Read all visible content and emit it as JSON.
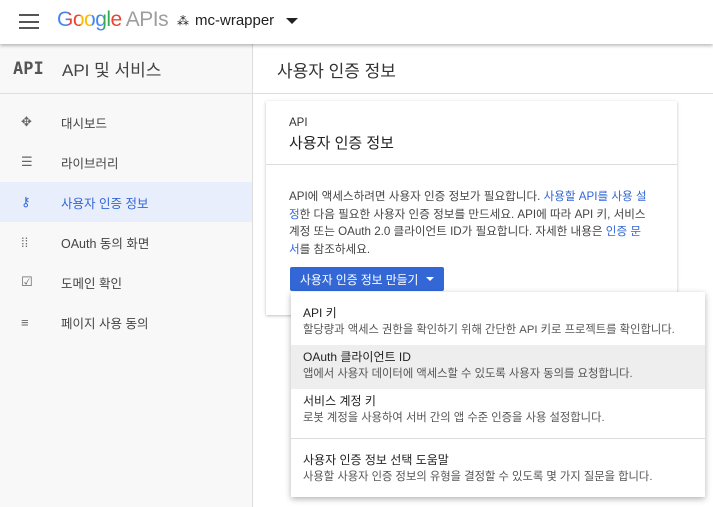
{
  "header": {
    "logo_google": "Google",
    "logo_apis": "APIs",
    "project": "mc-wrapper"
  },
  "sidebar": {
    "badge": "API",
    "title": "API 및 서비스",
    "items": [
      {
        "label": "대시보드",
        "icon": "dashboard-icon"
      },
      {
        "label": "라이브러리",
        "icon": "library-icon"
      },
      {
        "label": "사용자 인증 정보",
        "icon": "key-icon",
        "active": true
      },
      {
        "label": "OAuth 동의 화면",
        "icon": "consent-icon"
      },
      {
        "label": "도메인 확인",
        "icon": "checkbox-icon"
      },
      {
        "label": "페이지 사용 동의",
        "icon": "settings-list-icon"
      }
    ]
  },
  "main": {
    "title": "사용자 인증 정보"
  },
  "card": {
    "eyebrow": "API",
    "title": "사용자 인증 정보",
    "desc1": "API에 액세스하려면 사용자 인증 정보가 필요합니다. ",
    "link1": "사용할 API를 사용 설정",
    "desc2": "한 다음 필요한 사용자 인증 정보를 만드세요. API에 따라 API 키, 서비스 계정 또는 OAuth 2.0 클라이언트 ID가 필요합니다. 자세한 내용은 ",
    "link2": "인증 문서",
    "desc3": "를 참조하세요.",
    "button": "사용자 인증 정보 만들기"
  },
  "dropdown": [
    {
      "title": "API 키",
      "sub": "할당량과 액세스 권한을 확인하기 위해 간단한 API 키로 프로젝트를 확인합니다."
    },
    {
      "title": "OAuth 클라이언트 ID",
      "sub": "앱에서 사용자 데이터에 액세스할 수 있도록 사용자 동의를 요청합니다."
    },
    {
      "title": "서비스 계정 키",
      "sub": "로봇 계정을 사용하여 서버 간의 앱 수준 인증을 사용 설정합니다."
    },
    {
      "title": "사용자 인증 정보 선택 도움말",
      "sub": "사용할 사용자 인증 정보의 유형을 결정할 수 있도록 몇 가지 질문을 합니다."
    }
  ]
}
